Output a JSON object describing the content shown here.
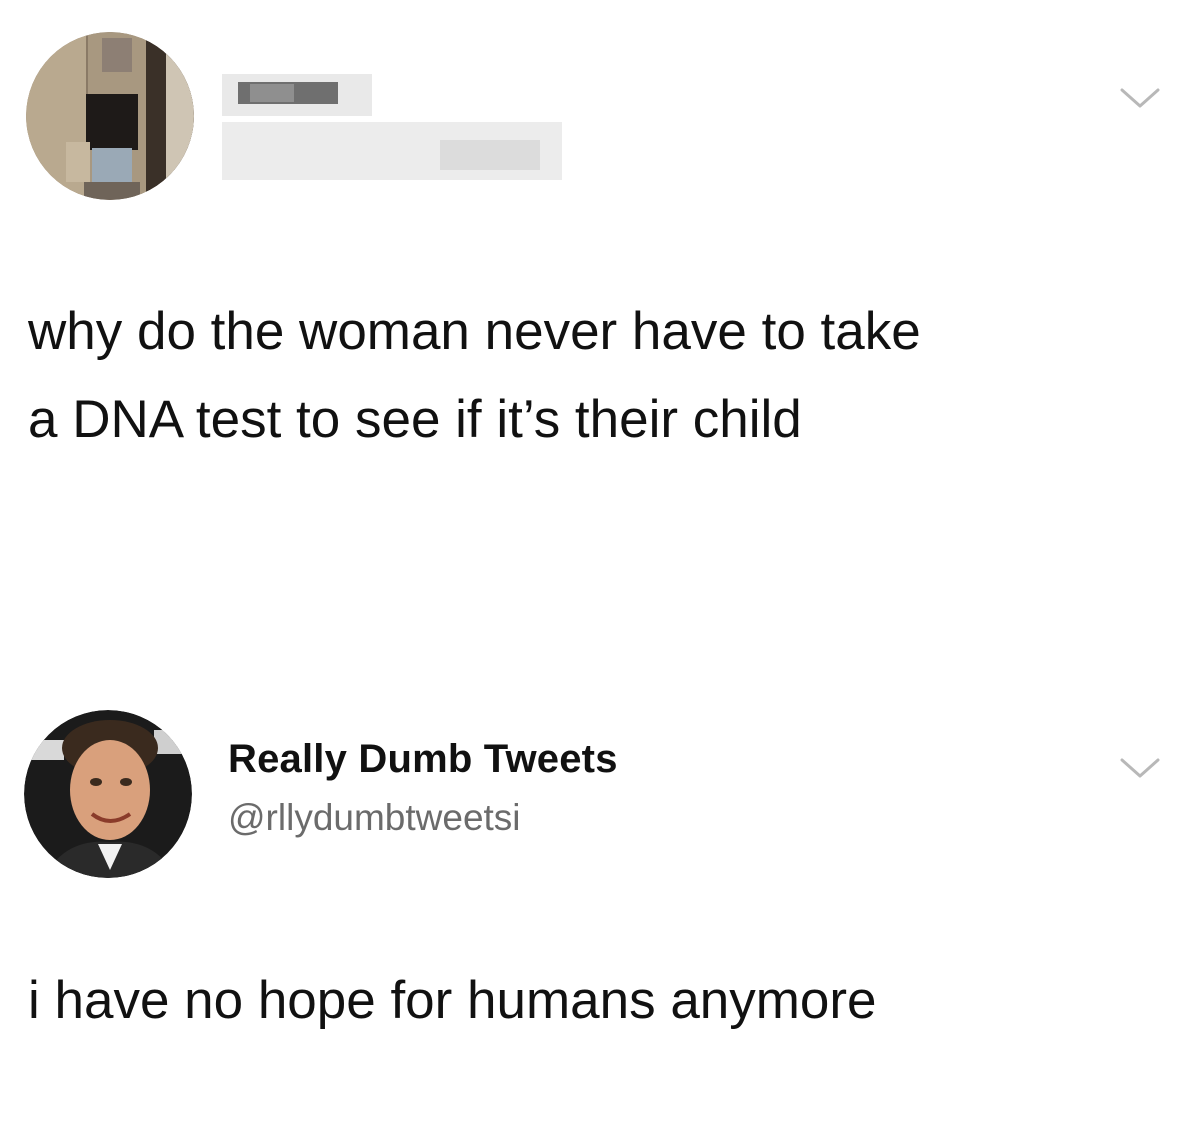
{
  "tweets": [
    {
      "author": {
        "display_name": "",
        "handle": "",
        "name_obscured": true,
        "avatar_obscured": true
      },
      "text_lines": [
        "why do the woman never have to take",
        "a DNA test to see if it’s their child"
      ],
      "menu_icon": "chevron-down-icon"
    },
    {
      "author": {
        "display_name": "Really Dumb Tweets",
        "handle": "@rllydumbtweetsi"
      },
      "text_lines": [
        "i have no hope for humans anymore"
      ],
      "menu_icon": "chevron-down-icon"
    }
  ],
  "colors": {
    "background": "#ffffff",
    "text": "#111111",
    "handle": "#6b6b6b",
    "chevron": "#b8b8b8"
  }
}
